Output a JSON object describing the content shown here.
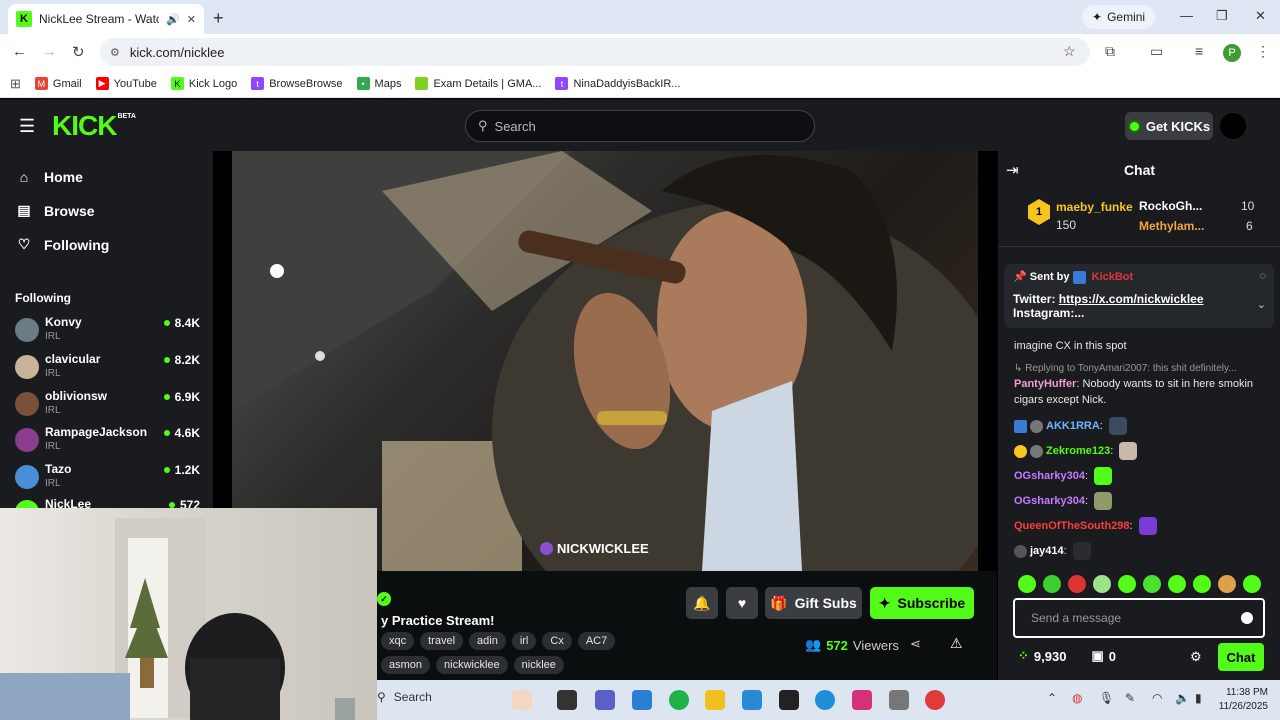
{
  "browser": {
    "tab_title": "NickLee Stream - Watch Liv",
    "gemini_label": "Gemini",
    "url": "kick.com/nicklee",
    "profile_initial": "P",
    "bookmarks": [
      {
        "label": "Gmail",
        "color": "#ea4335"
      },
      {
        "label": "YouTube",
        "color": "#ff0000"
      },
      {
        "label": "Kick Logo",
        "color": "#53fc18"
      },
      {
        "label": "BrowseBrowse",
        "color": "#9146ff"
      },
      {
        "label": "Maps",
        "color": "#34a853"
      },
      {
        "label": "Exam Details | GMA...",
        "color": "#7ed321"
      },
      {
        "label": "NinaDaddyisBackIR...",
        "color": "#9146ff"
      }
    ]
  },
  "header": {
    "logo": "KICK",
    "logo_beta": "BETA",
    "search_placeholder": "Search",
    "get_kicks": "Get KICKs"
  },
  "sidebar": {
    "nav": [
      {
        "label": "Home",
        "icon": "home-icon"
      },
      {
        "label": "Browse",
        "icon": "browse-icon"
      },
      {
        "label": "Following",
        "icon": "heart-icon"
      }
    ],
    "following_heading": "Following",
    "following": [
      {
        "name": "Konvy",
        "category": "IRL",
        "viewers": "8.4K"
      },
      {
        "name": "clavicular",
        "category": "IRL",
        "viewers": "8.2K"
      },
      {
        "name": "oblivionsw",
        "category": "IRL",
        "viewers": "6.9K"
      },
      {
        "name": "RampageJackson",
        "category": "IRL",
        "viewers": "4.6K"
      },
      {
        "name": "Tazo",
        "category": "IRL",
        "viewers": "1.2K"
      },
      {
        "name": "NickLee",
        "category": "",
        "viewers": "572"
      }
    ]
  },
  "video": {
    "watermark": "NICKWICKLEE"
  },
  "stream": {
    "title": "y Practice Stream!",
    "tags_row1": [
      "xqc",
      "travel",
      "adin",
      "irl",
      "Cx",
      "AC7"
    ],
    "tags_row2": [
      "asmon",
      "nickwicklee",
      "nicklee"
    ],
    "gift_subs": "Gift Subs",
    "subscribe": "Subscribe",
    "viewer_count": "572",
    "viewers_label": "Viewers"
  },
  "chat": {
    "title": "Chat",
    "top_gifters": [
      {
        "name": "maeby_funke",
        "count": "150"
      },
      {
        "name": "RockoGh...",
        "count": "10"
      },
      {
        "name": "Methylam...",
        "count": "6"
      }
    ],
    "pinned": {
      "sent_by": "Sent by",
      "bot": "KickBot",
      "line1_label": "Twitter:",
      "line1_link": "https://x.com/nickwicklee",
      "line2": "Instagram:..."
    },
    "messages": [
      {
        "user": "",
        "text": "imagine CX in this spot",
        "color": "#ffffff"
      },
      {
        "user": "",
        "text": "Replying to TonyAmari2007: this shit definitely...",
        "color": "#999999"
      },
      {
        "user": "PantyHuffer",
        "text": "Nobody wants to sit in here smokin cigars except Nick.",
        "color": "#f29bd1"
      },
      {
        "user": "AKK1RRA",
        "text": "",
        "color": "#6eb5ff"
      },
      {
        "user": "Zekrome123",
        "text": "",
        "color": "#53fc18"
      },
      {
        "user": "OGsharky304",
        "text": "",
        "color": "#c47bff"
      },
      {
        "user": "OGsharky304",
        "text": "",
        "color": "#c47bff"
      },
      {
        "user": "QueenOfTheSouth298",
        "text": "",
        "color": "#ff3b3b"
      },
      {
        "user": "jay414",
        "text": "",
        "color": "#ffffff"
      }
    ],
    "input_placeholder": "Send a message",
    "points": "9,930",
    "drops": "0",
    "send_label": "Chat"
  },
  "taskbar": {
    "search": "Search",
    "time": "11:38 PM",
    "date": "11/26/2025"
  }
}
